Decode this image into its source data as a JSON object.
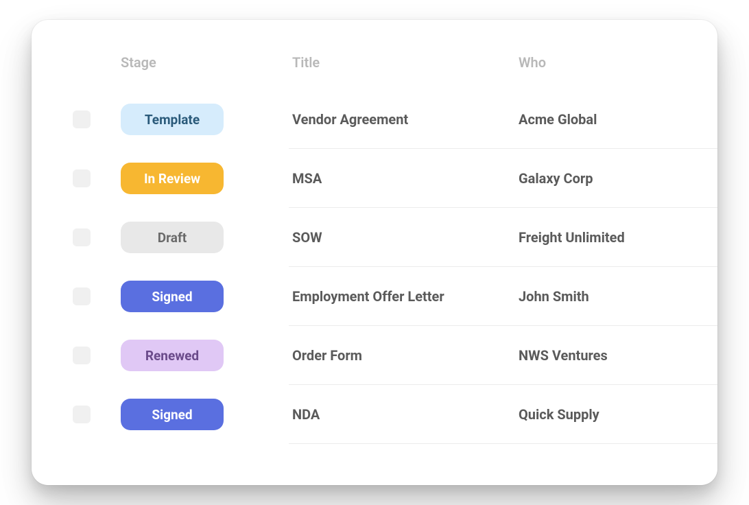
{
  "headers": {
    "stage": "Stage",
    "title": "Title",
    "who": "Who"
  },
  "stageColors": {
    "template": {
      "bg": "#d6ecfc",
      "fg": "#2a5a7a"
    },
    "inReview": {
      "bg": "#f7b731",
      "fg": "#ffffff"
    },
    "draft": {
      "bg": "#e8e8e8",
      "fg": "#6a6a6a"
    },
    "signed": {
      "bg": "#5a6fe0",
      "fg": "#ffffff"
    },
    "renewed": {
      "bg": "#e0c8f5",
      "fg": "#6a4a8a"
    }
  },
  "rows": [
    {
      "stage": "Template",
      "stageKey": "template",
      "title": "Vendor Agreement",
      "who": "Acme Global"
    },
    {
      "stage": "In Review",
      "stageKey": "inReview",
      "title": "MSA",
      "who": "Galaxy Corp"
    },
    {
      "stage": "Draft",
      "stageKey": "draft",
      "title": "SOW",
      "who": "Freight Unlimited"
    },
    {
      "stage": "Signed",
      "stageKey": "signed",
      "title": "Employment Offer Letter",
      "who": "John Smith"
    },
    {
      "stage": "Renewed",
      "stageKey": "renewed",
      "title": "Order Form",
      "who": "NWS Ventures"
    },
    {
      "stage": "Signed",
      "stageKey": "signed",
      "title": "NDA",
      "who": "Quick Supply"
    }
  ]
}
